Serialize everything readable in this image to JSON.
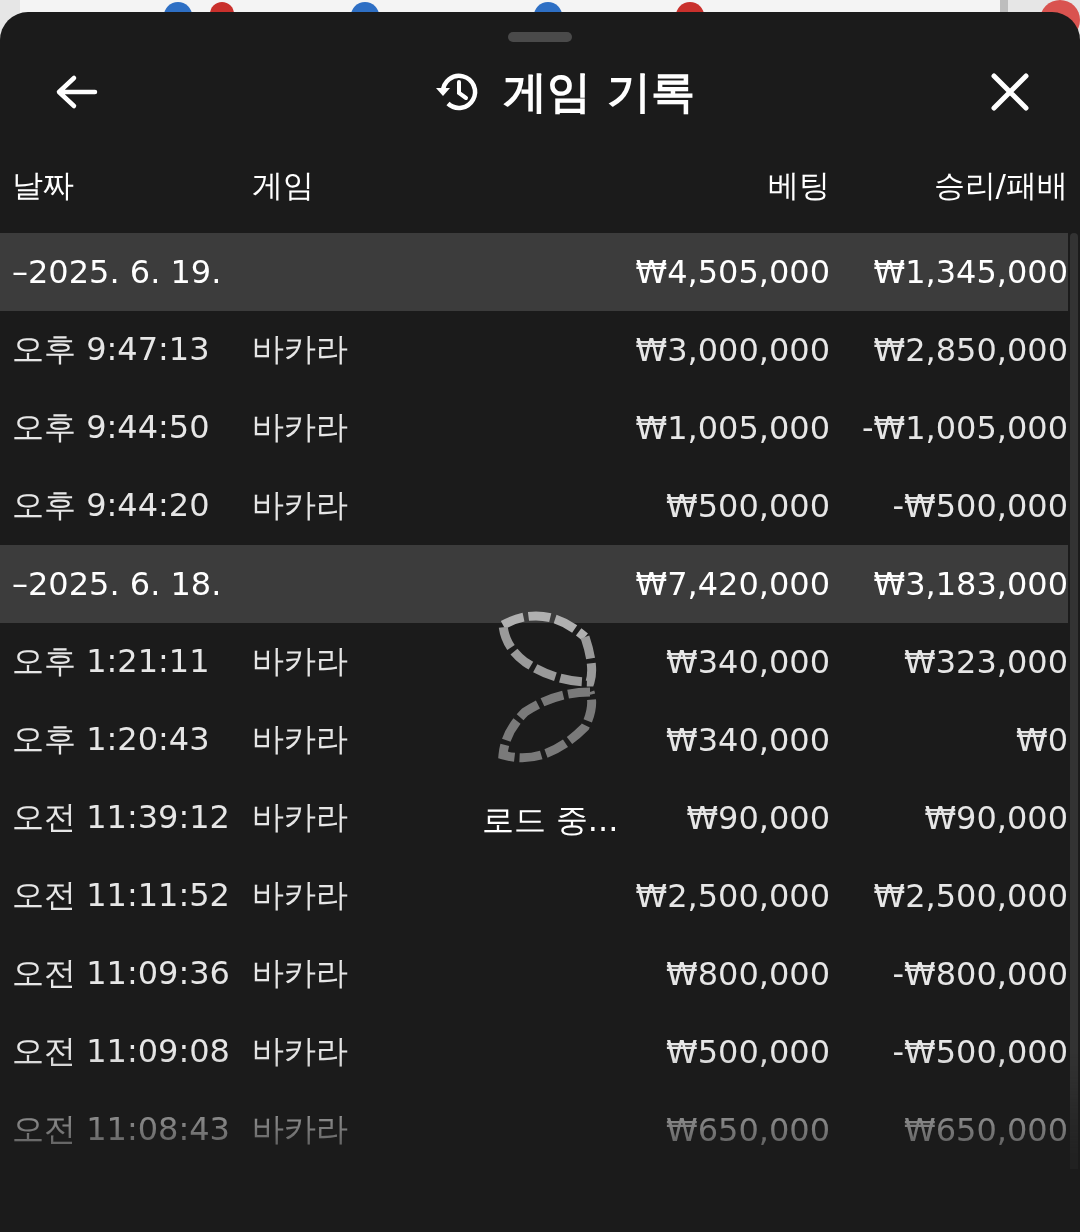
{
  "sheet": {
    "title": "게임 기록"
  },
  "table": {
    "columns": [
      "날짜",
      "게임",
      "베팅",
      "승리/패배"
    ],
    "groups": [
      {
        "date": "–2025. 6. 19.",
        "bet": "₩4,505,000",
        "result": "₩1,345,000",
        "rows": [
          {
            "time": "오후 9:47:13",
            "game": "바카라",
            "bet": "₩3,000,000",
            "result": "₩2,850,000"
          },
          {
            "time": "오후 9:44:50",
            "game": "바카라",
            "bet": "₩1,005,000",
            "result": "-₩1,005,000"
          },
          {
            "time": "오후 9:44:20",
            "game": "바카라",
            "bet": "₩500,000",
            "result": "-₩500,000"
          }
        ]
      },
      {
        "date": "–2025. 6. 18.",
        "bet": "₩7,420,000",
        "result": "₩3,183,000",
        "rows": [
          {
            "time": "오후 1:21:11",
            "game": "바카라",
            "bet": "₩340,000",
            "result": "₩323,000"
          },
          {
            "time": "오후 1:20:43",
            "game": "바카라",
            "bet": "₩340,000",
            "result": "₩0"
          },
          {
            "time": "오전 11:39:12",
            "game": "바카라",
            "bet": "₩90,000",
            "result": "₩90,000"
          },
          {
            "time": "오전 11:11:52",
            "game": "바카라",
            "bet": "₩2,500,000",
            "result": "₩2,500,000"
          },
          {
            "time": "오전 11:09:36",
            "game": "바카라",
            "bet": "₩800,000",
            "result": "-₩800,000"
          },
          {
            "time": "오전 11:09:08",
            "game": "바카라",
            "bet": "₩500,000",
            "result": "-₩500,000"
          },
          {
            "time": "오전 11:08:43",
            "game": "바카라",
            "bet": "₩650,000",
            "result": "₩650,000"
          }
        ]
      }
    ]
  },
  "loading": {
    "text": "로드 중..."
  }
}
